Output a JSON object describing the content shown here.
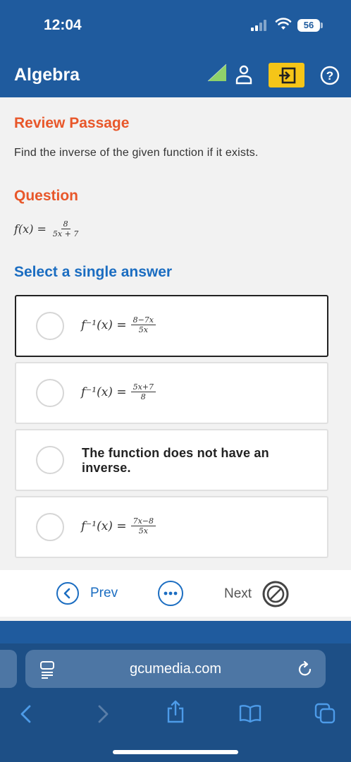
{
  "status": {
    "time": "12:04",
    "battery": "56"
  },
  "header": {
    "title": "Algebra"
  },
  "content": {
    "review_heading": "Review Passage",
    "prompt": "Find the inverse of the given function if it exists.",
    "question_heading": "Question",
    "function_lhs": "f(x) =",
    "function_num": "8",
    "function_den": "5x + 7",
    "select_heading": "Select a single answer",
    "choices": [
      {
        "lhs": "f⁻¹(x) =",
        "num": "8−7x",
        "den": "5x",
        "selected": true
      },
      {
        "lhs": "f⁻¹(x) =",
        "num": "5x+7",
        "den": "8",
        "selected": false
      },
      {
        "text": "The function does not have an inverse.",
        "selected": false
      },
      {
        "lhs": "f⁻¹(x) =",
        "num": "7x−8",
        "den": "5x",
        "selected": false
      }
    ]
  },
  "nav": {
    "prev_label": "Prev",
    "next_label": "Next"
  },
  "browser": {
    "url": "gcumedia.com"
  },
  "colors": {
    "header_blue": "#1f5b9e",
    "accent_orange": "#e8572a",
    "link_blue": "#1b6dc1",
    "exit_yellow": "#f5c518"
  }
}
